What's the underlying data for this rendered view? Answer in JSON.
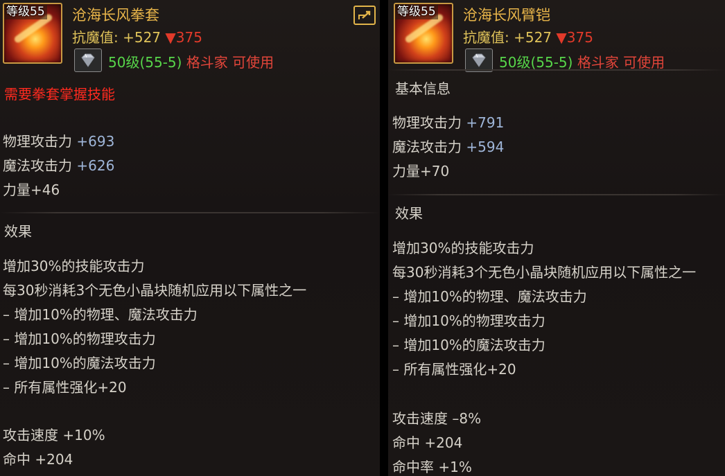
{
  "left": {
    "level_badge": "等级55",
    "title": "沧海长风拳套",
    "resist_label": "抗魔值: +527",
    "resist_down": "▼375",
    "req_level": "50级(55-5)",
    "req_class": "格斗家 可使用",
    "warning": "需要拳套掌握技能",
    "phys_label": "物理攻击力",
    "phys_val": "+693",
    "mag_label": "魔法攻击力",
    "mag_val": "+626",
    "str": "力量+46",
    "effect_header": "效果",
    "effects": [
      "增加30%的技能攻击力",
      "每30秒消耗3个无色小晶块随机应用以下属性之一",
      "– 增加10%的物理、魔法攻击力",
      "– 增加10%的物理攻击力",
      "– 增加10%的魔法攻击力",
      "– 所有属性强化+20"
    ],
    "attack_speed": "攻击速度 +10%",
    "hit": "命中 +204"
  },
  "right": {
    "level_badge": "等级55",
    "title": "沧海长风臂铠",
    "resist_label": "抗魔值: +527",
    "resist_down": "▼375",
    "req_level": "50级(55-5)",
    "req_class": "格斗家 可使用",
    "basic_header": "基本信息",
    "phys_label": "物理攻击力",
    "phys_val": "+791",
    "mag_label": "魔法攻击力",
    "mag_val": "+594",
    "str": "力量+70",
    "effect_header": "效果",
    "effects": [
      "增加30%的技能攻击力",
      "每30秒消耗3个无色小晶块随机应用以下属性之一",
      "– 增加10%的物理、魔法攻击力",
      "– 增加10%的物理攻击力",
      "– 增加10%的魔法攻击力",
      "– 所有属性强化+20"
    ],
    "attack_speed": "攻击速度 –8%",
    "hit": "命中 +204",
    "hit_rate": "命中率 +1%"
  },
  "icons": {
    "item_icon": "gauntlet-item-icon",
    "gem": "diamond-gem-icon",
    "share": "share-export-icon"
  },
  "colors": {
    "title": "#e8b54a",
    "level_req": "#57d64a",
    "class_req": "#e2453a",
    "warning": "#ff2a1f",
    "stat_value": "#9fb6d9"
  }
}
